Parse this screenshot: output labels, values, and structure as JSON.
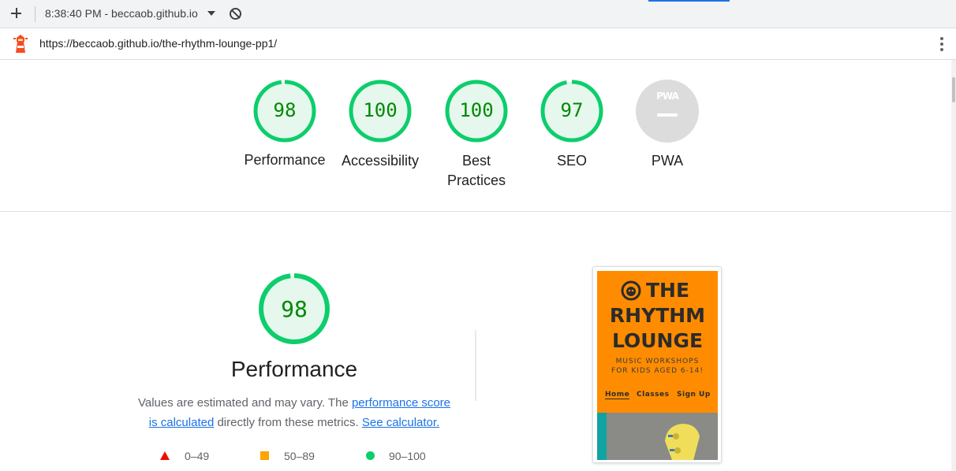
{
  "toolbar": {
    "run_label": "8:38:40 PM - beccaob.github.io"
  },
  "urlbar": {
    "url": "https://beccaob.github.io/the-rhythm-lounge-pp1/"
  },
  "gauges": [
    {
      "label": "Performance",
      "value": "98",
      "score": 98
    },
    {
      "label": "Accessibility",
      "value": "100",
      "score": 100
    },
    {
      "label_line1": "Best",
      "label_line2": "Practices",
      "value": "100",
      "score": 100
    },
    {
      "label": "SEO",
      "value": "97",
      "score": 97
    },
    {
      "label": "PWA",
      "badge": "PWA"
    }
  ],
  "performance": {
    "value": "98",
    "score": 98,
    "title": "Performance",
    "desc_prefix": "Values are estimated and may vary. The ",
    "desc_link1": "performance score is calculated",
    "desc_middle": " directly from these metrics. ",
    "desc_link2": "See calculator.",
    "legend": [
      {
        "range": "0–49",
        "shape": "triangle",
        "color": "#eb0f00"
      },
      {
        "range": "50–89",
        "shape": "square",
        "color": "#ffa400"
      },
      {
        "range": "90–100",
        "shape": "circle",
        "color": "#0cce6b"
      }
    ]
  },
  "screenshot": {
    "title_line1": "THE",
    "title_line2": "RHYTHM",
    "title_line3": "LOUNGE",
    "subtitle_line1": "MUSIC WORKSHOPS",
    "subtitle_line2": "FOR KIDS AGED 6-14!",
    "nav": [
      "Home",
      "Classes",
      "Sign Up"
    ]
  },
  "colors": {
    "pass_green": "#0cce6b",
    "pass_text": "#008800",
    "pass_fill": "#e6f8ee",
    "link_blue": "#1a73e8",
    "site_orange": "#ff8c00"
  },
  "icons": [
    "plus-icon",
    "chevron-down-icon",
    "block-icon",
    "lighthouse-icon",
    "more-vert-icon"
  ]
}
